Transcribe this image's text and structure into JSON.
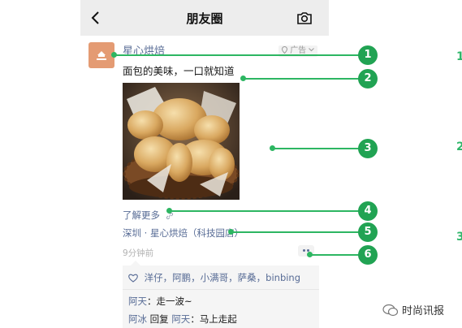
{
  "header": {
    "title": "朋友圈"
  },
  "post": {
    "author": "星心烘焙",
    "ad_label": "广告",
    "text": "面包的美味，一口就知道",
    "learn_more": "了解更多",
    "location": "深圳 · 星心烘焙（科技园店）",
    "time": "9分钟前",
    "likes": "洋仔，阿鹏，小满哥，萨桑，binbing",
    "comments": [
      {
        "name": "阿天",
        "sep": "：",
        "text": "走一波~"
      },
      {
        "name": "阿冰",
        "mid": " 回复 ",
        "target": "阿天",
        "sep": "：",
        "text": "马上走起"
      }
    ]
  },
  "annotations": [
    "1",
    "2",
    "3",
    "4",
    "5",
    "6"
  ],
  "watermark": "时尚讯报",
  "edge_numbers": [
    "1",
    "2",
    "3"
  ],
  "colors": {
    "accent": "#576b95",
    "annotation": "#21a353",
    "avatar": "#e49b73"
  }
}
